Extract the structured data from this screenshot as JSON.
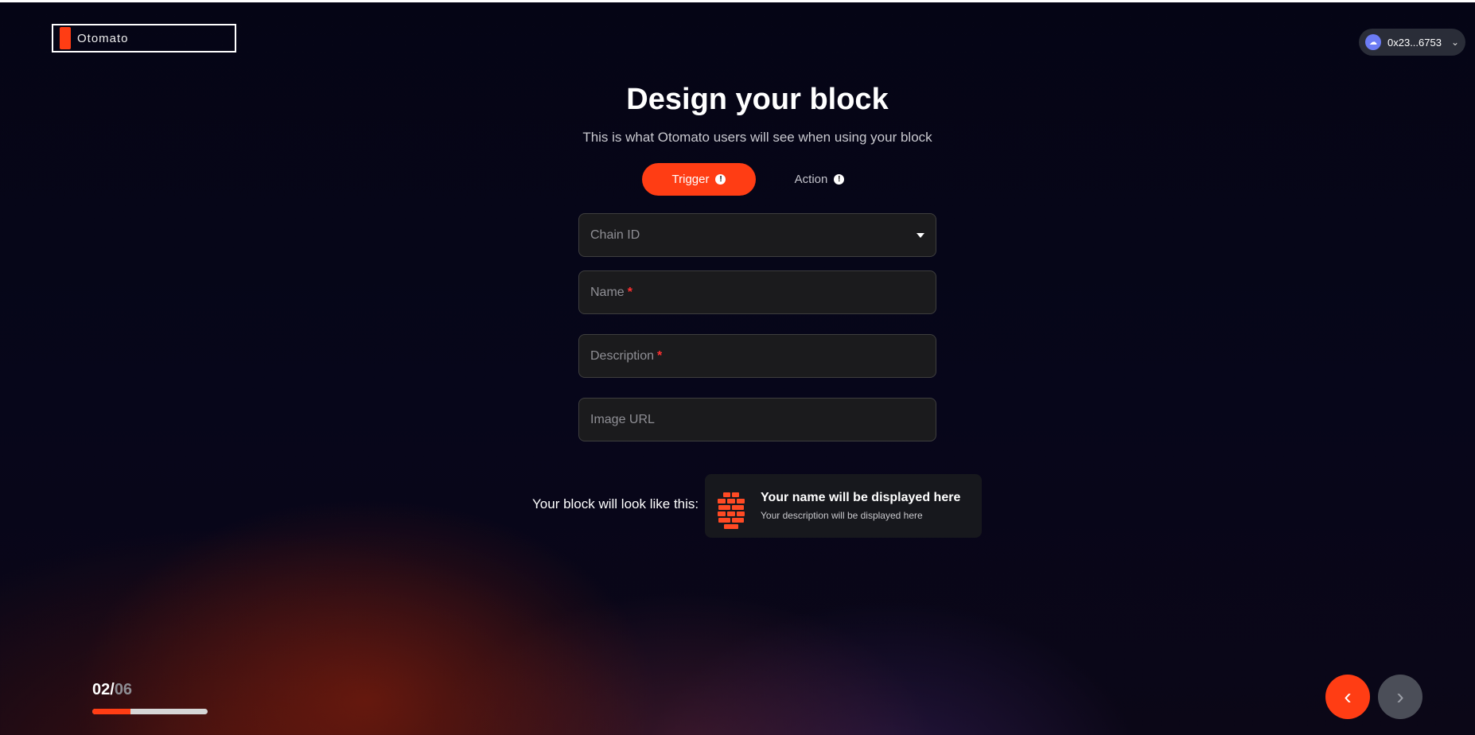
{
  "header": {
    "logo_text": "Otomato",
    "wallet_address": "0x23...6753",
    "wallet_avatar_icon": "cloud-icon",
    "chevron_icon": "chevron-down-icon"
  },
  "main": {
    "title": "Design your block",
    "subtitle": "This is what Otomato users will see when using your block",
    "tabs": [
      {
        "label": "Trigger",
        "active": true
      },
      {
        "label": "Action",
        "active": false
      }
    ],
    "fields": {
      "chain_id": {
        "placeholder": "Chain ID"
      },
      "name": {
        "placeholder": "Name",
        "required_mark": "*"
      },
      "description": {
        "placeholder": "Description",
        "required_mark": "*"
      },
      "image_url": {
        "placeholder": "Image URL"
      }
    },
    "preview": {
      "label": "Your block will look like this:",
      "name": "Your name will be displayed here",
      "description": "Your description will be displayed here",
      "icon": "brick-wall-icon"
    }
  },
  "footer": {
    "step_current": "02/",
    "step_total": "06",
    "progress_fraction": 0.33
  },
  "colors": {
    "accent": "#ff3d14",
    "background": "#050515",
    "field_bg": "#1b1b1d",
    "required": "#ff3030"
  }
}
